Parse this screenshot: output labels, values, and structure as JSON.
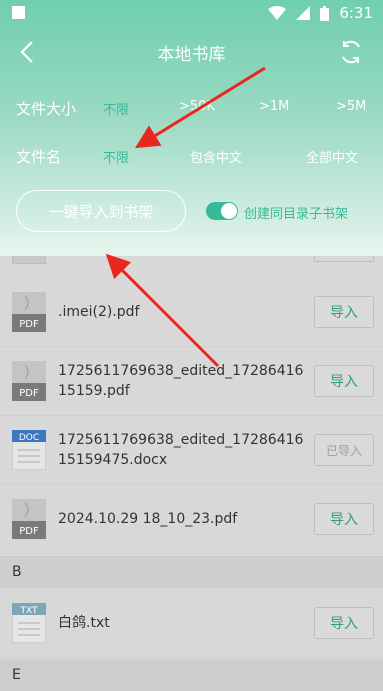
{
  "statusbar": {
    "time": "6:31"
  },
  "titlebar": {
    "title": "本地书库"
  },
  "filters": {
    "size": {
      "label": "文件大小",
      "options": [
        "不限",
        ">50K",
        ">1M",
        ">5M"
      ]
    },
    "name": {
      "label": "文件名",
      "options": [
        "不限",
        "包含中文",
        "全部中文"
      ]
    }
  },
  "actions": {
    "import_all": "一键导入到书架",
    "create_same_dir": "创建同目录子书架"
  },
  "files": [
    {
      "name": ".imei(2).pdf",
      "type": "PDF",
      "button": "导入"
    },
    {
      "name": "1725611769638_edited_1728641615159.pdf",
      "type": "PDF",
      "button": "导入"
    },
    {
      "name": "1725611769638_edited_1728641615159475.docx",
      "type": "DOC",
      "button": "已导入"
    },
    {
      "name": "2024.10.29 18_10_23.pdf",
      "type": "PDF",
      "button": "导入"
    }
  ],
  "sections": [
    {
      "letter": "B",
      "files": [
        {
          "name": "白鸽.txt",
          "type": "TXT",
          "button": "导入"
        }
      ]
    },
    {
      "letter": "E"
    }
  ],
  "colors": {
    "accent": "#39b89a",
    "header_top": "#6fcfae",
    "arrow": "#e8281e"
  }
}
